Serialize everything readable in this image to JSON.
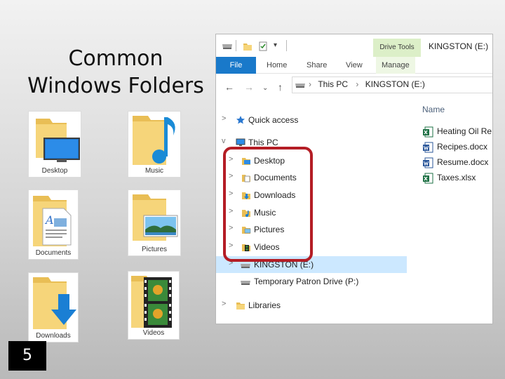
{
  "slide": {
    "title_line1": "Common",
    "title_line2": "Windows Folders",
    "page_number": "5"
  },
  "tiles": [
    {
      "label": "Desktop",
      "icon": "desktop-folder-icon"
    },
    {
      "label": "Music",
      "icon": "music-folder-icon"
    },
    {
      "label": "Documents",
      "icon": "documents-folder-icon"
    },
    {
      "label": "Pictures",
      "icon": "pictures-folder-icon"
    },
    {
      "label": "Downloads",
      "icon": "downloads-folder-icon"
    },
    {
      "label": "Videos",
      "icon": "videos-folder-icon"
    }
  ],
  "explorer": {
    "window_title": "KINGSTON (E:)",
    "context_tab": "Drive Tools",
    "tabs": [
      "File",
      "Home",
      "Share",
      "View",
      "Manage"
    ],
    "breadcrumb": [
      "This PC",
      "KINGSTON (E:)"
    ],
    "nav": [
      {
        "label": "Quick access",
        "icon": "star-icon",
        "expander": ">"
      },
      {
        "label": "This PC",
        "icon": "computer-icon",
        "expander": "v"
      },
      {
        "label": "Desktop",
        "icon": "desktop-icon",
        "expander": ">"
      },
      {
        "label": "Documents",
        "icon": "documents-icon",
        "expander": ">"
      },
      {
        "label": "Downloads",
        "icon": "downloads-icon",
        "expander": ">"
      },
      {
        "label": "Music",
        "icon": "music-icon",
        "expander": ">"
      },
      {
        "label": "Pictures",
        "icon": "pictures-icon",
        "expander": ">"
      },
      {
        "label": "Videos",
        "icon": "videos-icon",
        "expander": ">"
      },
      {
        "label": "KINGSTON (E:)",
        "icon": "drive-icon",
        "expander": ">"
      },
      {
        "label": "Temporary Patron Drive (P:)",
        "icon": "drive-icon",
        "expander": ""
      },
      {
        "label": "Libraries",
        "icon": "libraries-icon",
        "expander": ">"
      }
    ],
    "column_header": "Name",
    "files": [
      {
        "label": "Heating Oil Re",
        "icon": "excel-icon"
      },
      {
        "label": "Recipes.docx",
        "icon": "word-icon"
      },
      {
        "label": "Resume.docx",
        "icon": "word-icon"
      },
      {
        "label": "Taxes.xlsx",
        "icon": "excel-icon"
      }
    ]
  },
  "colors": {
    "file_tab": "#1979ca",
    "highlight": "#b41d25",
    "selected_row": "#cce8ff",
    "drive_tools": "#dcefc8",
    "folder": "#f6d57a"
  }
}
